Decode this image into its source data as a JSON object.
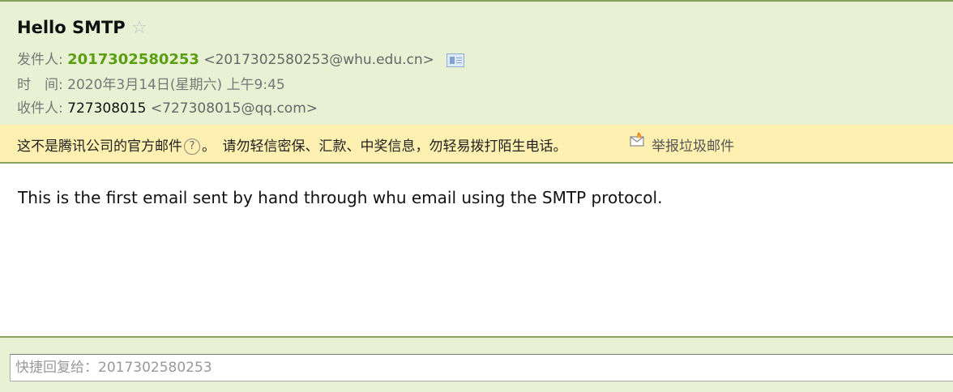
{
  "email": {
    "subject": "Hello SMTP",
    "star_icon": "☆",
    "from_label": "发件人:",
    "from_name": "2017302580253",
    "from_address": "<2017302580253@whu.edu.cn>",
    "time_label": "时　间:",
    "time_value": "2020年3月14日(星期六) 上午9:45",
    "to_label": "收件人:",
    "to_name": "727308015",
    "to_address": "<727308015@qq.com>"
  },
  "warning": {
    "text_part1": "这不是腾讯公司的官方邮件",
    "help_icon": "?",
    "text_part2": "。　请勿轻信密保、汇款、中奖信息，勿轻易拨打陌生电话。",
    "report_label": "举报垃圾邮件"
  },
  "body": {
    "text": "This is the first email sent by hand through whu email using the SMTP protocol."
  },
  "quick_reply": {
    "placeholder": "快捷回复给：2017302580253"
  },
  "colors": {
    "header_bg": "#e9f1d5",
    "warning_bg": "#fdf0b0",
    "accent_green": "#5a9e12",
    "border_green": "#8aa35a"
  },
  "icons": {
    "star": "star-icon",
    "contact_card": "contact-card-icon",
    "help": "help-icon",
    "report": "report-spam-icon"
  }
}
